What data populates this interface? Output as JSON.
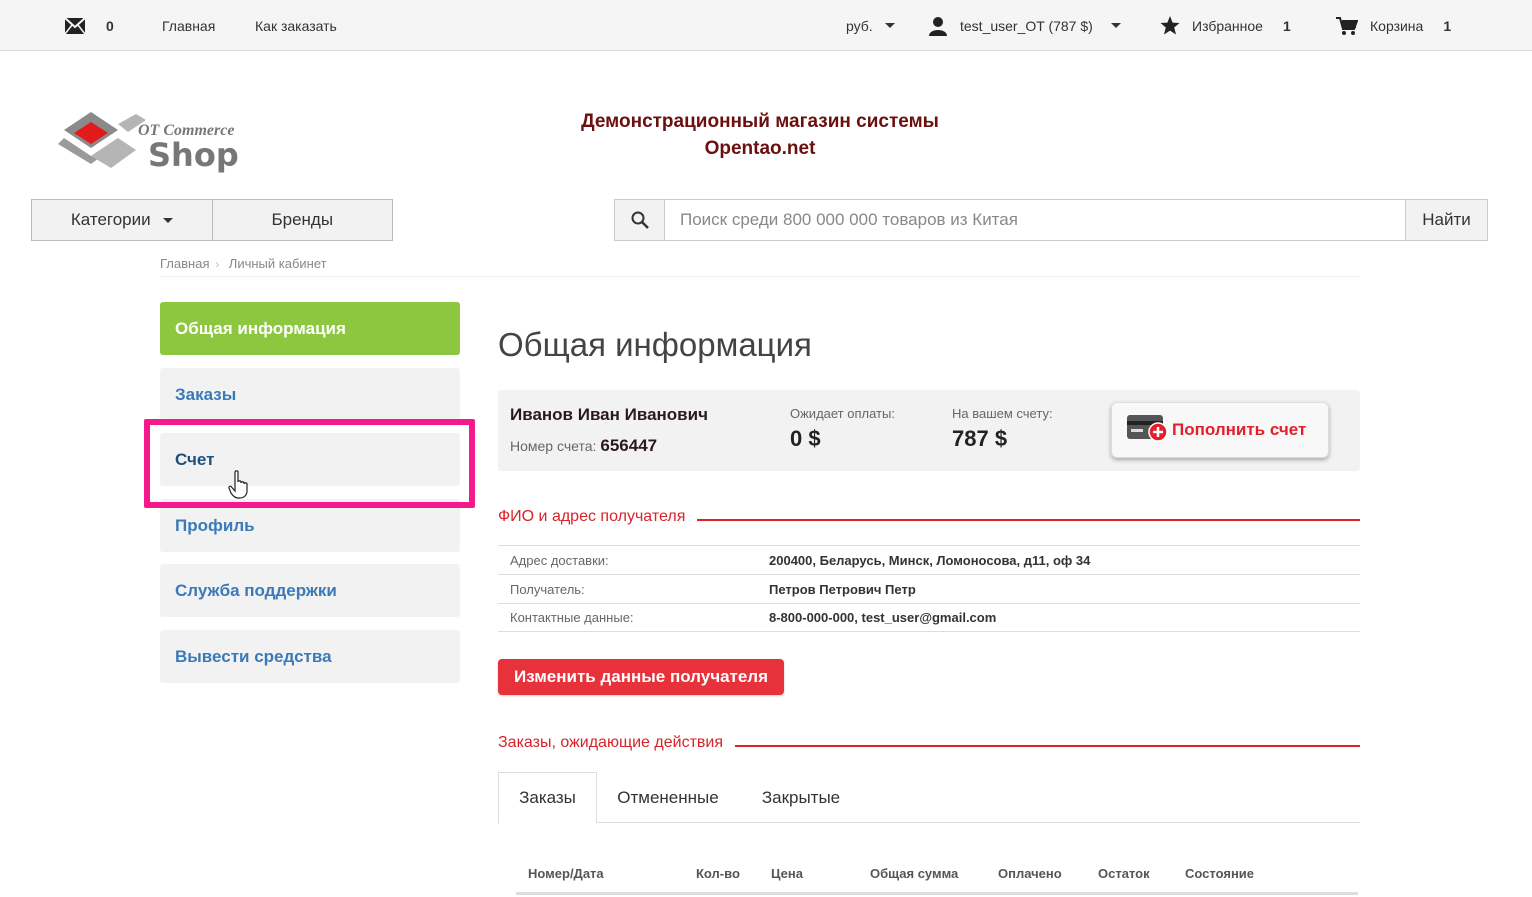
{
  "topbar": {
    "messages_count": "0",
    "nav_home": "Главная",
    "nav_how_to_order": "Как заказать",
    "currency": "руб.",
    "user": "test_user_OT (787 $)",
    "favorites_label": "Избранное",
    "favorites_count": "1",
    "cart_label": "Корзина",
    "cart_count": "1"
  },
  "logo": {
    "top_text": "OT Commerce",
    "main_text": "Shop"
  },
  "shop_title": {
    "line1": "Демонстрационный магазин системы",
    "line2": "Opentao.net"
  },
  "nav": {
    "categories": "Категории",
    "brands": "Бренды"
  },
  "search": {
    "placeholder": "Поиск среди 800 000 000 товаров из Китая",
    "button": "Найти"
  },
  "breadcrumb": {
    "home": "Главная",
    "current": "Личный кабинет"
  },
  "sidebar": {
    "items": [
      {
        "label": "Общая информация"
      },
      {
        "label": "Заказы"
      },
      {
        "label": "Счет"
      },
      {
        "label": "Профиль"
      },
      {
        "label": "Служба поддержки"
      },
      {
        "label": "Вывести средства"
      }
    ]
  },
  "main": {
    "title": "Общая информация",
    "account": {
      "name": "Иванов Иван Иванович",
      "number_label": "Номер счета:",
      "number": "656447",
      "awaiting_label": "Ожидает оплаты:",
      "awaiting_value": "0 $",
      "balance_label": "На вашем счету:",
      "balance_value": "787 $",
      "topup_button": "Пополнить счет"
    },
    "recipient_section": "ФИО и адрес получателя",
    "recipient": [
      {
        "key": "Адрес доставки:",
        "value": "200400, Беларусь, Минск, Ломоносова, д11, оф 34"
      },
      {
        "key": "Получатель:",
        "value": "Петров Петрович Петр"
      },
      {
        "key": "Контактные данные:",
        "value": "8-800-000-000, test_user@gmail.com"
      }
    ],
    "edit_button": "Изменить данные получателя",
    "orders_section": "Заказы, ожидающие действия",
    "tabs": [
      "Заказы",
      "Отмененные",
      "Закрытые"
    ],
    "columns": [
      "Номер/Дата",
      "Кол-во",
      "Цена",
      "Общая сумма",
      "Оплачено",
      "Остаток",
      "Состояние"
    ]
  },
  "colors": {
    "accent_green": "#8dc63f",
    "accent_red": "#d8232a",
    "highlight": "#f5198c",
    "link_blue": "#3b7ab8"
  }
}
